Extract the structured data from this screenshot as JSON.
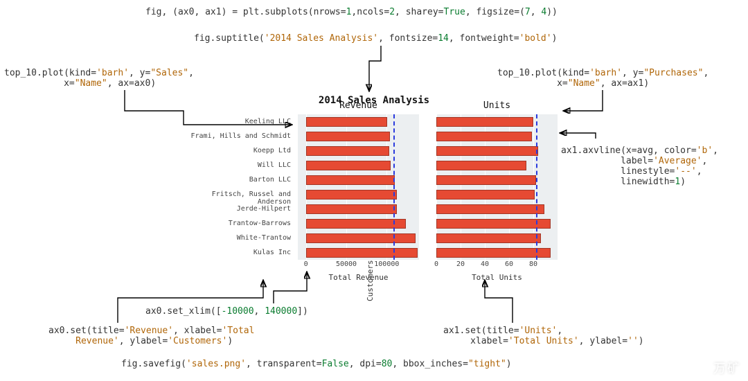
{
  "code": {
    "subplots": "fig, (ax0, ax1) = plt.subplots(nrows=1,ncols=2, sharey=True, figsize=(7, 4))",
    "suptitle": "fig.suptitle('2014 Sales Analysis', fontsize=14, fontweight='bold')",
    "plot_left_a": "top_10.plot(kind='barh', y=\"Sales\",",
    "plot_left_b": "           x=\"Name\", ax=ax0)",
    "plot_right_a": "top_10.plot(kind='barh', y=\"Purchases\",",
    "plot_right_b": "           x=\"Name\", ax=ax1)",
    "axvline_a": "ax1.axvline(x=avg, color='b',",
    "axvline_b": "           label='Average',",
    "axvline_c": "           linestyle='--',",
    "axvline_d": "           linewidth=1)",
    "set_xlim": "ax0.set_xlim([-10000, 140000])",
    "ax0_set_a": "ax0.set(title='Revenue', xlabel='Total",
    "ax0_set_b": "     Revenue', ylabel='Customers')",
    "ax1_set_a": "ax1.set(title='Units',",
    "ax1_set_b": "     xlabel='Total Units', ylabel='')",
    "savefig": "fig.savefig('sales.png', transparent=False, dpi=80, bbox_inches=\"tight\")"
  },
  "chart_data": [
    {
      "type": "bar",
      "orientation": "horizontal",
      "title": "Revenue",
      "suptitle": "2014 Sales Analysis",
      "xlabel": "Total Revenue",
      "ylabel": "Customers",
      "xlim": [
        -10000,
        140000
      ],
      "xticks": [
        0,
        50000,
        100000
      ],
      "categories": [
        "Keeling LLC",
        "Frami, Hills and Schmidt",
        "Koepp Ltd",
        "Will LLC",
        "Barton LLC",
        "Fritsch, Russel and Anderson",
        "Jerde-Hilpert",
        "Trantow-Barrows",
        "White-Trantow",
        "Kulas Inc"
      ],
      "values": [
        101000,
        104000,
        103000,
        105000,
        110000,
        113000,
        113000,
        124000,
        136000,
        138000
      ],
      "avg_line": 108000
    },
    {
      "type": "bar",
      "orientation": "horizontal",
      "title": "Units",
      "xlabel": "Total Units",
      "ylabel": "",
      "xlim": [
        0,
        100
      ],
      "xticks": [
        0,
        20,
        40,
        60,
        80
      ],
      "categories": [
        "Keeling LLC",
        "Frami, Hills and Schmidt",
        "Koepp Ltd",
        "Will LLC",
        "Barton LLC",
        "Fritsch, Russel and Anderson",
        "Jerde-Hilpert",
        "Trantow-Barrows",
        "White-Trantow",
        "Kulas Inc"
      ],
      "values": [
        80,
        79,
        84,
        74,
        82,
        81,
        89,
        94,
        86,
        94
      ],
      "avg_line": 82
    }
  ],
  "watermark": "万矿"
}
